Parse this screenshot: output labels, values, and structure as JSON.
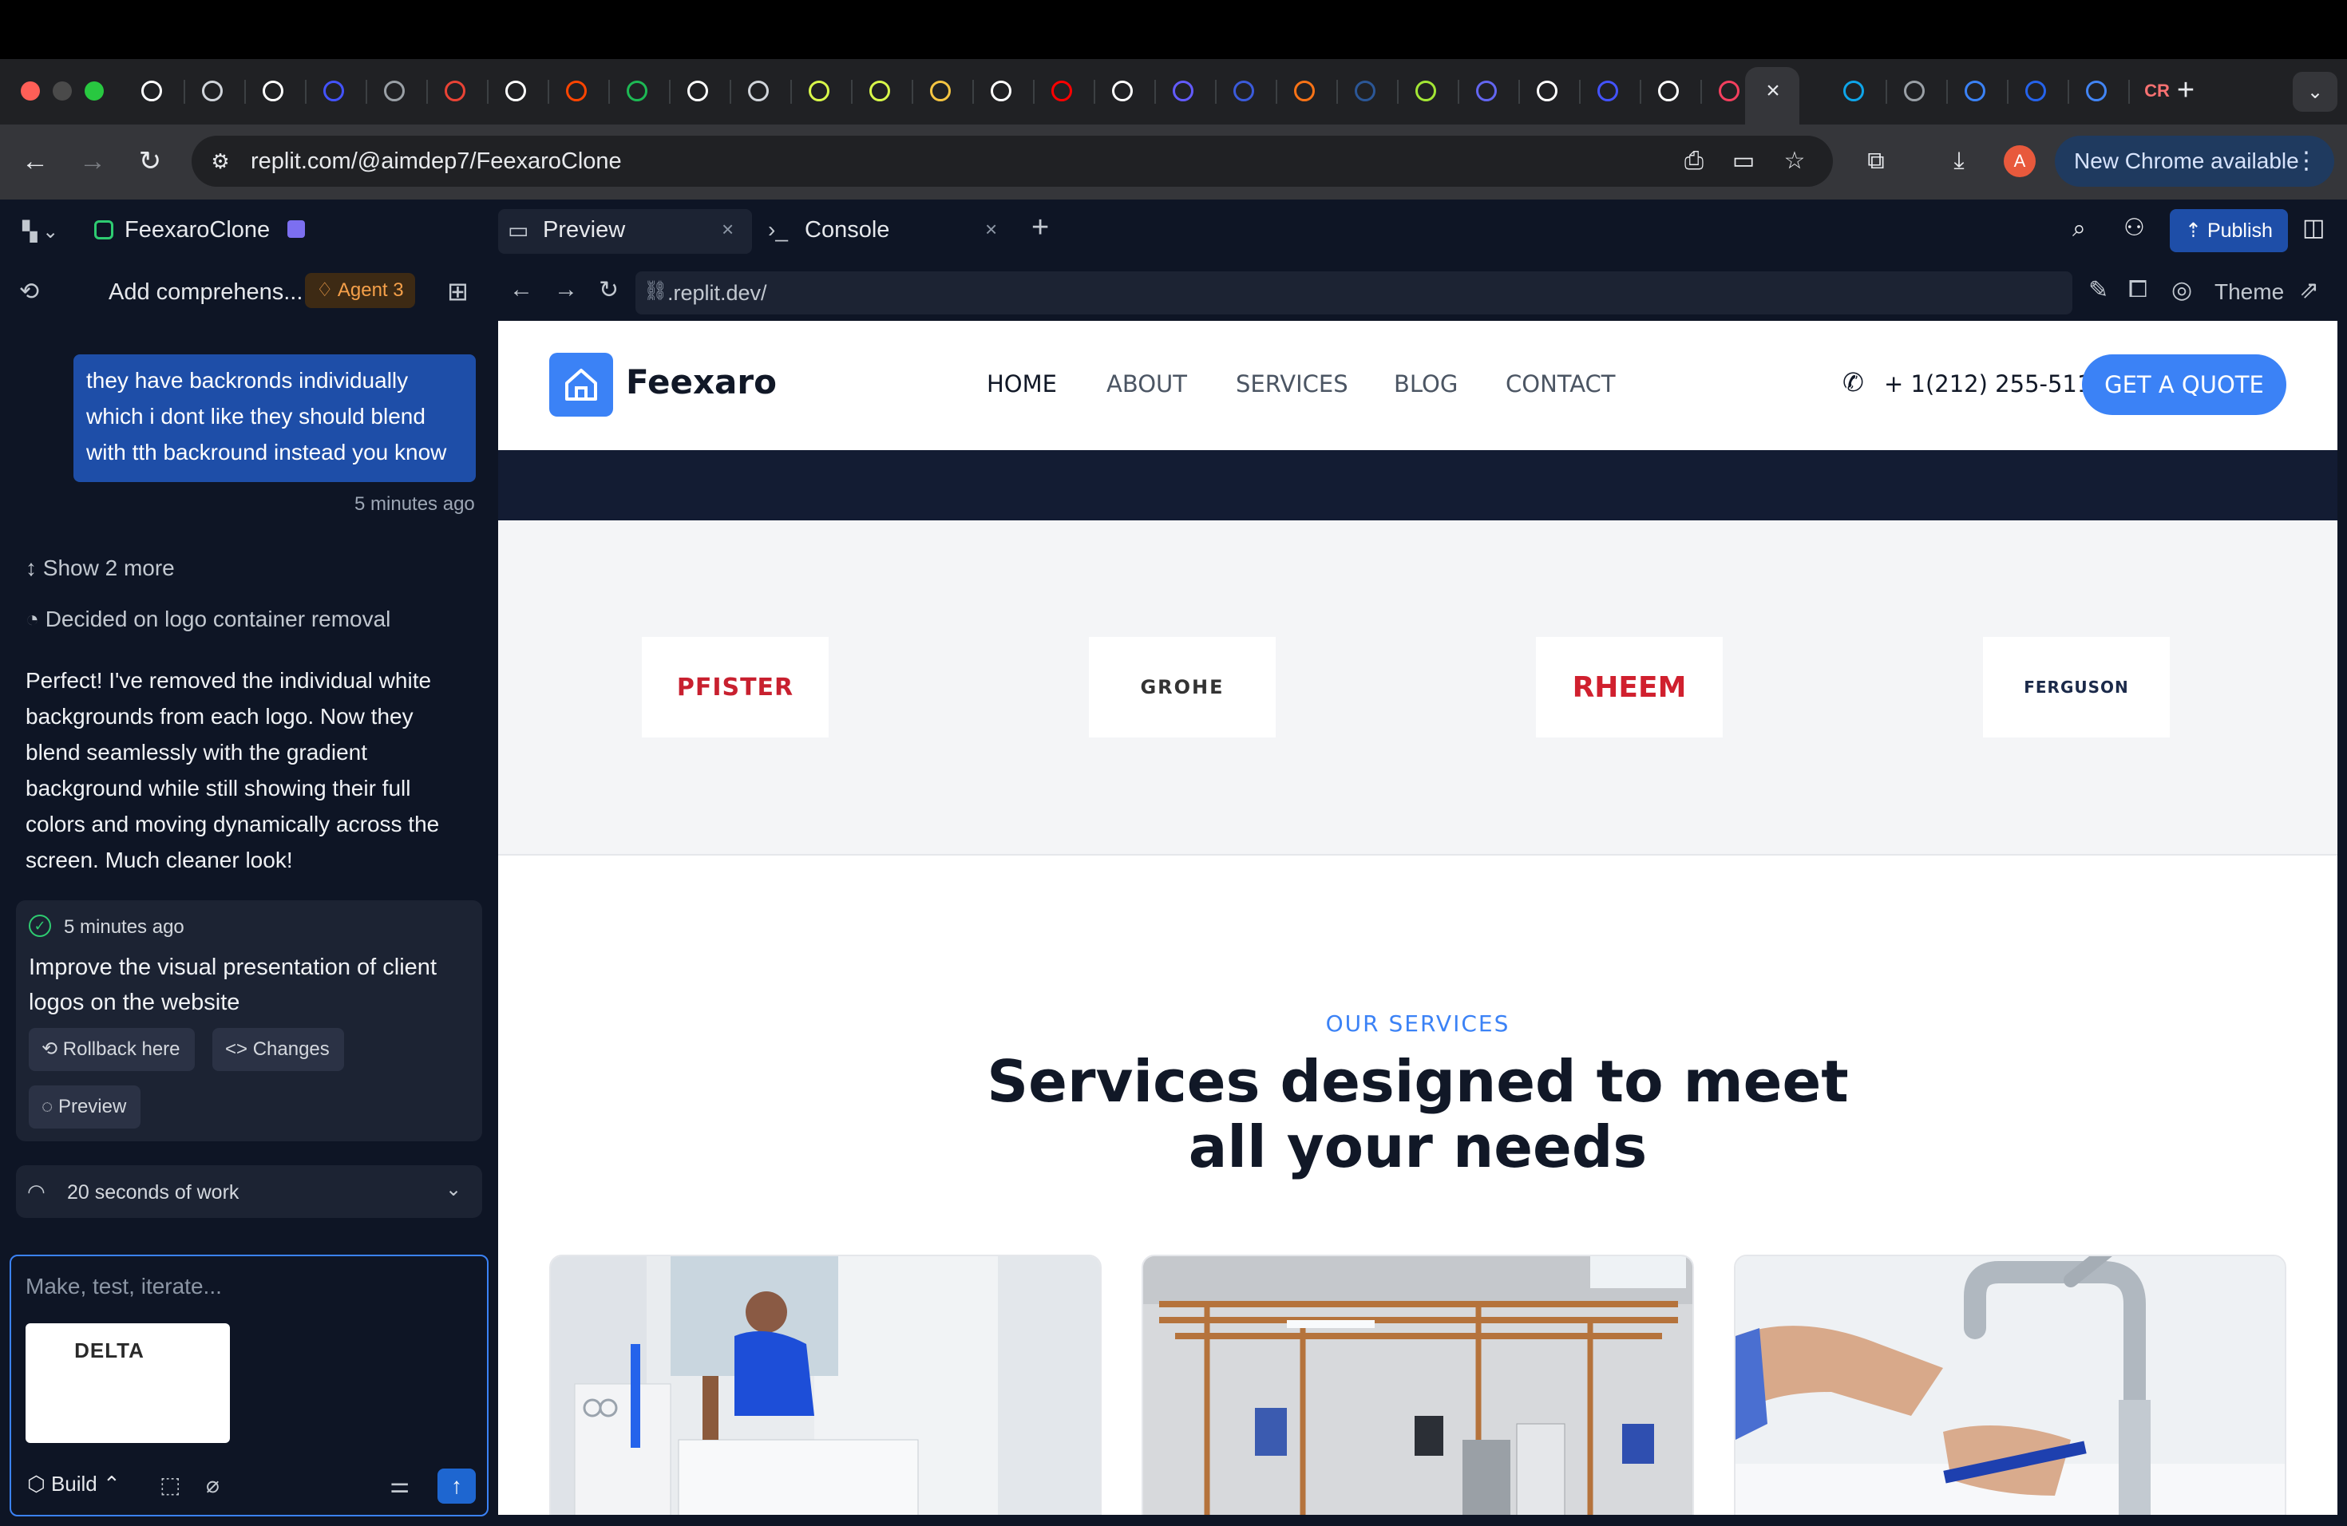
{
  "browser": {
    "url": "replit.com/@aimdep7/FeexaroClone",
    "update_label": "New Chrome available",
    "profile_initial": "A",
    "tab_favicons": [
      "framer",
      "openai",
      "framer",
      "webflow",
      "chrome",
      "gmail",
      "notion",
      "reddit",
      "spotify",
      "github",
      "openai",
      "lime",
      "lime",
      "emoji",
      "x",
      "youtube",
      "dice",
      "stripe",
      "calendar",
      "robot",
      "word",
      "lime-circle",
      "circle",
      "x",
      "webflow",
      "tick",
      "gradient",
      "active",
      "edge",
      "globe",
      "arrow",
      "as",
      "google",
      "cr"
    ],
    "tab_favicon_text": {
      "cr": "CR"
    }
  },
  "replit": {
    "repl_name": "FeexaroClone",
    "thread_title": "Add comprehens...",
    "agent_badge": "Agent 3",
    "user_message": "they have backronds individually which i dont like they should blend with tth backround instead you know",
    "user_message_time": "5 minutes ago",
    "show_more": "Show 2 more",
    "decision": "Decided on logo container removal",
    "agent_reply": "Perfect! I've removed the individual white backgrounds from each logo. Now they blend seamlessly with the gradient background while still showing their full colors and moving dynamically across the screen. Much cleaner look!",
    "checkpoint": {
      "time": "5 minutes ago",
      "description": "Improve the visual presentation of client logos on the website",
      "rollback_label": "Rollback here",
      "changes_label": "Changes",
      "preview_label": "Preview"
    },
    "work_summary": "20 seconds of work",
    "composer": {
      "placeholder": "Make, test, iterate...",
      "attachment_text": "DELTA",
      "build_label": "Build"
    },
    "pane_tabs": [
      "Preview",
      "Console"
    ],
    "publish_label": "Publish",
    "preview_url": ".replit.dev/",
    "theme_label": "Theme"
  },
  "site": {
    "brand": "Feexaro",
    "nav": [
      "HOME",
      "ABOUT",
      "SERVICES",
      "BLOG",
      "CONTACT"
    ],
    "phone": "+ 1(212) 255-511",
    "cta": "GET A QUOTE",
    "client_logos": [
      {
        "name": "PFISTER",
        "color": "#c8202f"
      },
      {
        "name": "GROHE",
        "color": "#333333"
      },
      {
        "name": "RHEEM",
        "color": "#d0202e"
      },
      {
        "name": "FERGUSON",
        "color": "#1b2a4a"
      }
    ],
    "services_eyebrow": "OUR SERVICES",
    "services_title_line1": "Services designed to meet",
    "services_title_line2": "all your needs"
  },
  "colors": {
    "accent": "#3b82f6",
    "replit_bg": "#0e1525",
    "chrome_tab": "#202124"
  }
}
